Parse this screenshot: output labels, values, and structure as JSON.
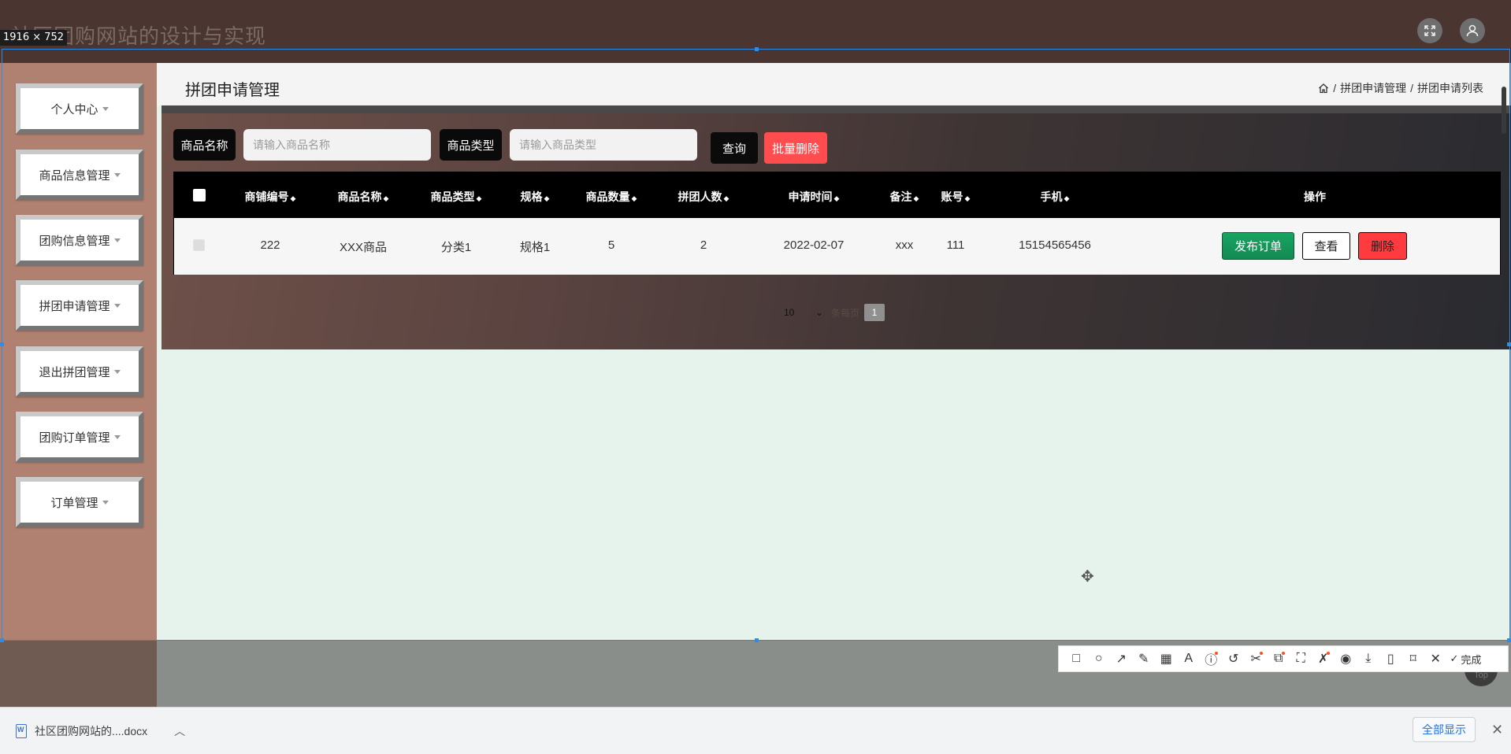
{
  "app": {
    "site_title": "社区团购网站的设计与实现",
    "header_icons": [
      "fullscreen-icon",
      "user-icon"
    ]
  },
  "sidebar": {
    "items": [
      {
        "label": "个人中心"
      },
      {
        "label": "商品信息管理"
      },
      {
        "label": "团购信息管理"
      },
      {
        "label": "拼团申请管理"
      },
      {
        "label": "退出拼团管理"
      },
      {
        "label": "团购订单管理"
      },
      {
        "label": "订单管理"
      }
    ]
  },
  "page": {
    "title": "拼团申请管理",
    "breadcrumb": {
      "sep": "/",
      "level1": "拼团申请管理",
      "level2": "拼团申请列表"
    }
  },
  "search": {
    "name_label": "商品名称",
    "name_placeholder": "请输入商品名称",
    "type_label": "商品类型",
    "type_placeholder": "请输入商品类型",
    "query_button": "查询",
    "batch_delete_button": "批量删除"
  },
  "table": {
    "columns": [
      "商铺编号",
      "商品名称",
      "商品类型",
      "规格",
      "商品数量",
      "拼团人数",
      "申请时间",
      "备注",
      "账号",
      "手机",
      "操作"
    ],
    "sort_glyph": "◆",
    "rows": [
      {
        "cells": [
          "222",
          "XXX商品",
          "分类1",
          "规格1",
          "5",
          "2",
          "2022-02-07",
          "xxx",
          "111",
          "15154565456"
        ],
        "actions": {
          "publish": "发布订单",
          "view": "查看",
          "delete": "删除"
        }
      }
    ]
  },
  "pagination": {
    "page_size": "10",
    "text": "条每页",
    "current_page": "1"
  },
  "screenshot_tool": {
    "size_label": "1916 × 752",
    "done_label": "完成",
    "back_top_label": "Top"
  },
  "download_bar": {
    "file_name": "社区团购网站的....docx",
    "show_all": "全部显示"
  },
  "colors": {
    "publish": "#19a463",
    "delete": "#ff3b40",
    "batch_delete": "#ff4d4f",
    "sidebar_bg": "#b08070",
    "selection": "#2b8de8"
  }
}
